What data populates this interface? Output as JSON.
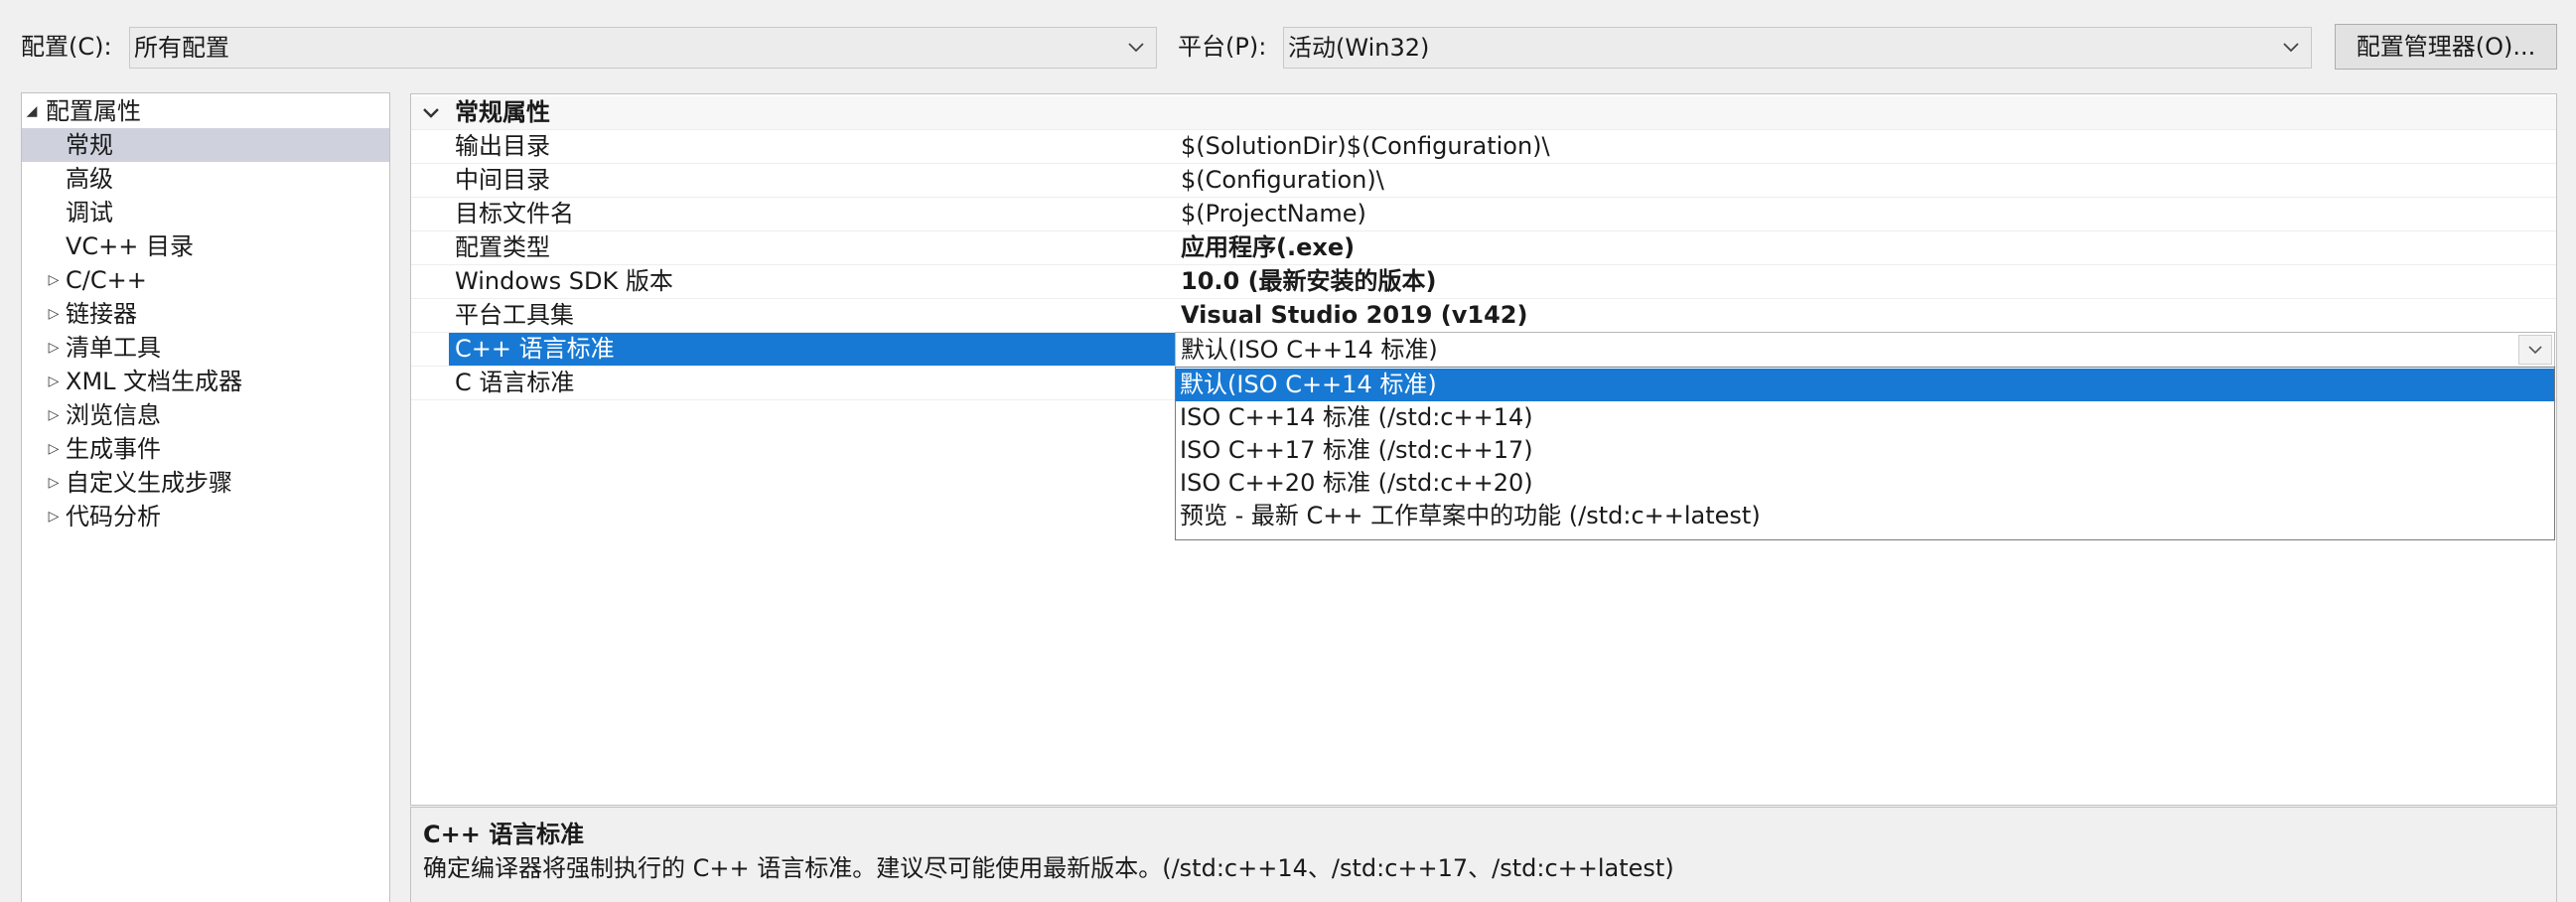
{
  "toolbar": {
    "config_label": "配置(C):",
    "config_value": "所有配置",
    "platform_label": "平台(P):",
    "platform_value": "活动(Win32)",
    "config_manager_button": "配置管理器(O)..."
  },
  "tree": {
    "root": "配置属性",
    "items": [
      {
        "label": "常规",
        "selected": true,
        "expandable": false
      },
      {
        "label": "高级",
        "expandable": false
      },
      {
        "label": "调试",
        "expandable": false
      },
      {
        "label": "VC++ 目录",
        "expandable": false
      },
      {
        "label": "C/C++",
        "expandable": true
      },
      {
        "label": "链接器",
        "expandable": true
      },
      {
        "label": "清单工具",
        "expandable": true
      },
      {
        "label": "XML 文档生成器",
        "expandable": true
      },
      {
        "label": "浏览信息",
        "expandable": true
      },
      {
        "label": "生成事件",
        "expandable": true
      },
      {
        "label": "自定义生成步骤",
        "expandable": true
      },
      {
        "label": "代码分析",
        "expandable": true
      }
    ]
  },
  "grid": {
    "category": "常规属性",
    "rows": [
      {
        "name": "输出目录",
        "value": "$(SolutionDir)$(Configuration)\\",
        "bold": false
      },
      {
        "name": "中间目录",
        "value": "$(Configuration)\\",
        "bold": false
      },
      {
        "name": "目标文件名",
        "value": "$(ProjectName)",
        "bold": false
      },
      {
        "name": "配置类型",
        "value": "应用程序(.exe)",
        "bold": true
      },
      {
        "name": "Windows SDK 版本",
        "value": "10.0 (最新安装的版本)",
        "bold": true
      },
      {
        "name": "平台工具集",
        "value": "Visual Studio 2019 (v142)",
        "bold": true
      },
      {
        "name": "C++ 语言标准",
        "value": "默认(ISO C++14 标准)",
        "bold": false,
        "selected": true
      },
      {
        "name": "C 语言标准",
        "value": "",
        "bold": false
      }
    ]
  },
  "dropdown": {
    "current": "默认(ISO C++14 标准)",
    "options": [
      {
        "label": "默认(ISO C++14 标准)",
        "highlighted": true
      },
      {
        "label": "ISO C++14 标准 (/std:c++14)"
      },
      {
        "label": "ISO C++17 标准 (/std:c++17)"
      },
      {
        "label": "ISO C++20 标准 (/std:c++20)"
      },
      {
        "label": "预览 - 最新 C++ 工作草案中的功能 (/std:c++latest)"
      }
    ]
  },
  "description": {
    "title": "C++ 语言标准",
    "text": "确定编译器将强制执行的 C++ 语言标准。建议尽可能使用最新版本。(/std:c++14、/std:c++17、/std:c++latest)"
  },
  "colors": {
    "selection": "#1779d4",
    "tree_selection": "#cfd2dc",
    "background": "#f0f0f0"
  }
}
